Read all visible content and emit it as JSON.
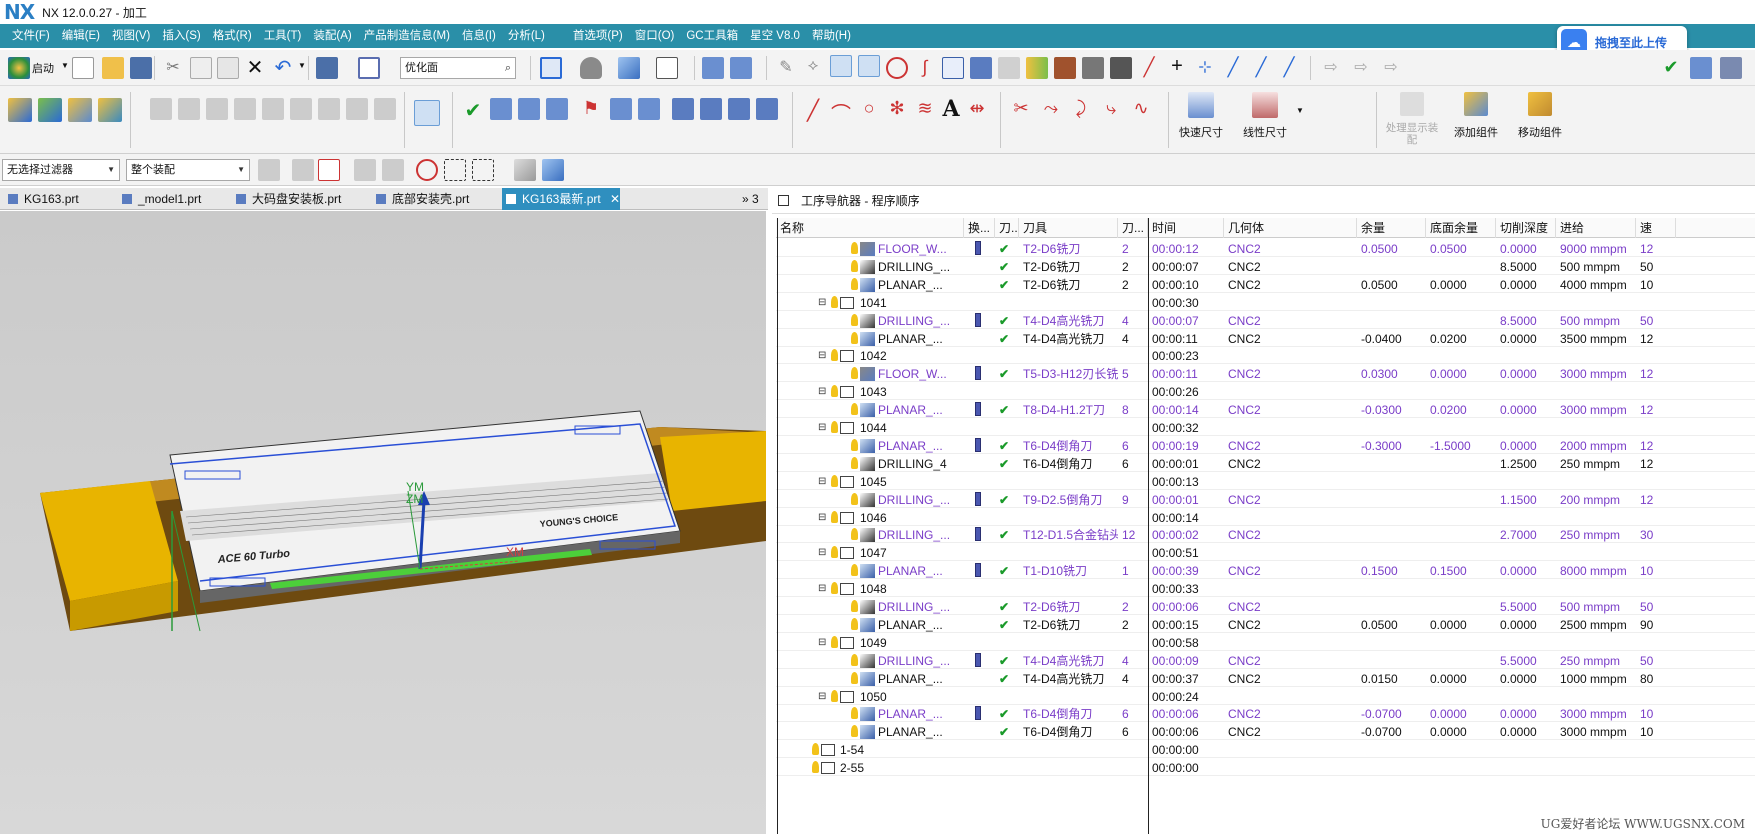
{
  "app": {
    "logo": "NX",
    "title": "NX 12.0.0.27 - 加工"
  },
  "menu": [
    "文件(F)",
    "编辑(E)",
    "视图(V)",
    "插入(S)",
    "格式(R)",
    "工具(T)",
    "装配(A)",
    "产品制造信息(M)",
    "信息(I)",
    "分析(L)",
    "首选项(P)",
    "窗口(O)",
    "GC工具箱",
    "星空 V8.0",
    "帮助(H)"
  ],
  "toolbar": {
    "start_label": "启动",
    "face_combo": "优化面",
    "filter_combo": "无选择过滤器",
    "assembly_combo": "整个装配"
  },
  "big_buttons": {
    "rapid_dim": "快速尺寸",
    "linear_dim": "线性尺寸",
    "process_display": "处理显示装配",
    "add_component": "添加组件",
    "move_component": "移动组件"
  },
  "upload_label": "拖拽至此上传",
  "tabs": [
    {
      "label": "KG163.prt"
    },
    {
      "label": "_model1.prt"
    },
    {
      "label": "大码盘安装板.prt"
    },
    {
      "label": "底部安装壳.prt"
    },
    {
      "label": "KG163最新.prt"
    }
  ],
  "tab_overflow": "» 3",
  "viewport": {
    "labels": {
      "ym": "YM",
      "zm": "ZM",
      "xm": "XM",
      "brand": "ACE 60 Turbo",
      "choice": "YOUNG'S CHOICE"
    }
  },
  "navigator": {
    "title": "工序导航器 - 程序顺序"
  },
  "columns": [
    "名称",
    "换...",
    "刀...",
    "刀具",
    "刀...",
    "时间",
    "几何体",
    "余量",
    "底面余量",
    "切削深度",
    "进给",
    "速"
  ],
  "rows": [
    {
      "type": "op",
      "name": "FLOOR_W...",
      "icon": "floor",
      "purple": true,
      "bar": true,
      "check": true,
      "tool": "T2-D6铣刀",
      "tnum": "2",
      "time": "00:00:12",
      "geom": "CNC2",
      "stock": "0.0500",
      "floor": "0.0500",
      "depth": "0.0000",
      "feed": "9000 mmpm",
      "speed": "12"
    },
    {
      "type": "op",
      "name": "DRILLING_...",
      "icon": "drill",
      "purple": false,
      "bar": false,
      "check": true,
      "tool": "T2-D6铣刀",
      "tnum": "2",
      "time": "00:00:07",
      "geom": "CNC2",
      "stock": "",
      "floor": "",
      "depth": "8.5000",
      "feed": "500 mmpm",
      "speed": "50"
    },
    {
      "type": "op",
      "name": "PLANAR_...",
      "icon": "planar",
      "purple": false,
      "bar": false,
      "check": true,
      "tool": "T2-D6铣刀",
      "tnum": "2",
      "time": "00:00:10",
      "geom": "CNC2",
      "stock": "0.0500",
      "floor": "0.0000",
      "depth": "0.0000",
      "feed": "4000 mmpm",
      "speed": "10"
    },
    {
      "type": "grp",
      "name": "1041",
      "time": "00:00:30"
    },
    {
      "type": "op",
      "name": "DRILLING_...",
      "icon": "drill",
      "purple": true,
      "bar": true,
      "check": true,
      "tool": "T4-D4高光铣刀",
      "tnum": "4",
      "time": "00:00:07",
      "geom": "CNC2",
      "stock": "",
      "floor": "",
      "depth": "8.5000",
      "feed": "500 mmpm",
      "speed": "50"
    },
    {
      "type": "op",
      "name": "PLANAR_...",
      "icon": "planar",
      "purple": false,
      "bar": false,
      "check": true,
      "tool": "T4-D4高光铣刀",
      "tnum": "4",
      "time": "00:00:11",
      "geom": "CNC2",
      "stock": "-0.0400",
      "floor": "0.0200",
      "depth": "0.0000",
      "feed": "3500 mmpm",
      "speed": "12"
    },
    {
      "type": "grp",
      "name": "1042",
      "time": "00:00:23"
    },
    {
      "type": "op",
      "name": "FLOOR_W...",
      "icon": "floor",
      "purple": true,
      "bar": true,
      "check": true,
      "tool": "T5-D3-H12刃长铣...",
      "tnum": "5",
      "time": "00:00:11",
      "geom": "CNC2",
      "stock": "0.0300",
      "floor": "0.0000",
      "depth": "0.0000",
      "feed": "3000 mmpm",
      "speed": "12"
    },
    {
      "type": "grp",
      "name": "1043",
      "time": "00:00:26"
    },
    {
      "type": "op",
      "name": "PLANAR_...",
      "icon": "planar",
      "purple": true,
      "bar": true,
      "check": true,
      "tool": "T8-D4-H1.2T刀",
      "tnum": "8",
      "time": "00:00:14",
      "geom": "CNC2",
      "stock": "-0.0300",
      "floor": "0.0200",
      "depth": "0.0000",
      "feed": "3000 mmpm",
      "speed": "12"
    },
    {
      "type": "grp",
      "name": "1044",
      "time": "00:00:32"
    },
    {
      "type": "op",
      "name": "PLANAR_...",
      "icon": "planar",
      "purple": true,
      "bar": true,
      "check": true,
      "tool": "T6-D4倒角刀",
      "tnum": "6",
      "time": "00:00:19",
      "geom": "CNC2",
      "stock": "-0.3000",
      "floor": "-1.5000",
      "depth": "0.0000",
      "feed": "2000 mmpm",
      "speed": "12"
    },
    {
      "type": "op",
      "name": "DRILLING_4",
      "icon": "drill",
      "purple": false,
      "bar": false,
      "check": true,
      "tool": "T6-D4倒角刀",
      "tnum": "6",
      "time": "00:00:01",
      "geom": "CNC2",
      "stock": "",
      "floor": "",
      "depth": "1.2500",
      "feed": "250 mmpm",
      "speed": "12"
    },
    {
      "type": "grp",
      "name": "1045",
      "time": "00:00:13"
    },
    {
      "type": "op",
      "name": "DRILLING_...",
      "icon": "drill",
      "purple": true,
      "bar": true,
      "check": true,
      "tool": "T9-D2.5倒角刀",
      "tnum": "9",
      "time": "00:00:01",
      "geom": "CNC2",
      "stock": "",
      "floor": "",
      "depth": "1.1500",
      "feed": "200 mmpm",
      "speed": "12"
    },
    {
      "type": "grp",
      "name": "1046",
      "time": "00:00:14"
    },
    {
      "type": "op",
      "name": "DRILLING_...",
      "icon": "drill",
      "purple": true,
      "bar": true,
      "check": true,
      "tool": "T12-D1.5合金钻头",
      "tnum": "12",
      "time": "00:00:02",
      "geom": "CNC2",
      "stock": "",
      "floor": "",
      "depth": "2.7000",
      "feed": "250 mmpm",
      "speed": "30"
    },
    {
      "type": "grp",
      "name": "1047",
      "time": "00:00:51"
    },
    {
      "type": "op",
      "name": "PLANAR_...",
      "icon": "planar",
      "purple": true,
      "bar": true,
      "check": true,
      "tool": "T1-D10铣刀",
      "tnum": "1",
      "time": "00:00:39",
      "geom": "CNC2",
      "stock": "0.1500",
      "floor": "0.1500",
      "depth": "0.0000",
      "feed": "8000 mmpm",
      "speed": "10"
    },
    {
      "type": "grp",
      "name": "1048",
      "time": "00:00:33"
    },
    {
      "type": "op",
      "name": "DRILLING_...",
      "icon": "drill",
      "purple": true,
      "bar": false,
      "check": true,
      "tool": "T2-D6铣刀",
      "tnum": "2",
      "time": "00:00:06",
      "geom": "CNC2",
      "stock": "",
      "floor": "",
      "depth": "5.5000",
      "feed": "500 mmpm",
      "speed": "50"
    },
    {
      "type": "op",
      "name": "PLANAR_...",
      "icon": "planar",
      "purple": false,
      "bar": false,
      "check": true,
      "tool": "T2-D6铣刀",
      "tnum": "2",
      "time": "00:00:15",
      "geom": "CNC2",
      "stock": "0.0500",
      "floor": "0.0000",
      "depth": "0.0000",
      "feed": "2500 mmpm",
      "speed": "90"
    },
    {
      "type": "grp",
      "name": "1049",
      "time": "00:00:58"
    },
    {
      "type": "op",
      "name": "DRILLING_...",
      "icon": "drill",
      "purple": true,
      "bar": true,
      "check": true,
      "tool": "T4-D4高光铣刀",
      "tnum": "4",
      "time": "00:00:09",
      "geom": "CNC2",
      "stock": "",
      "floor": "",
      "depth": "5.5000",
      "feed": "250 mmpm",
      "speed": "50"
    },
    {
      "type": "op",
      "name": "PLANAR_...",
      "icon": "planar",
      "purple": false,
      "bar": false,
      "check": true,
      "tool": "T4-D4高光铣刀",
      "tnum": "4",
      "time": "00:00:37",
      "geom": "CNC2",
      "stock": "0.0150",
      "floor": "0.0000",
      "depth": "0.0000",
      "feed": "1000 mmpm",
      "speed": "80"
    },
    {
      "type": "grp",
      "name": "1050",
      "time": "00:00:24"
    },
    {
      "type": "op",
      "name": "PLANAR_...",
      "icon": "planar",
      "purple": true,
      "bar": true,
      "check": true,
      "tool": "T6-D4倒角刀",
      "tnum": "6",
      "time": "00:00:06",
      "geom": "CNC2",
      "stock": "-0.0700",
      "floor": "0.0000",
      "depth": "0.0000",
      "feed": "3000 mmpm",
      "speed": "10"
    },
    {
      "type": "op",
      "name": "PLANAR_...",
      "icon": "planar",
      "purple": false,
      "bar": false,
      "check": true,
      "tool": "T6-D4倒角刀",
      "tnum": "6",
      "time": "00:00:06",
      "geom": "CNC2",
      "stock": "-0.0700",
      "floor": "0.0000",
      "depth": "0.0000",
      "feed": "3000 mmpm",
      "speed": "10"
    },
    {
      "type": "top",
      "name": "1-54",
      "time": "00:00:00"
    },
    {
      "type": "top",
      "name": "2-55",
      "time": "00:00:00"
    }
  ],
  "watermark": "UG爱好者论坛 WWW.UGSNX.COM"
}
